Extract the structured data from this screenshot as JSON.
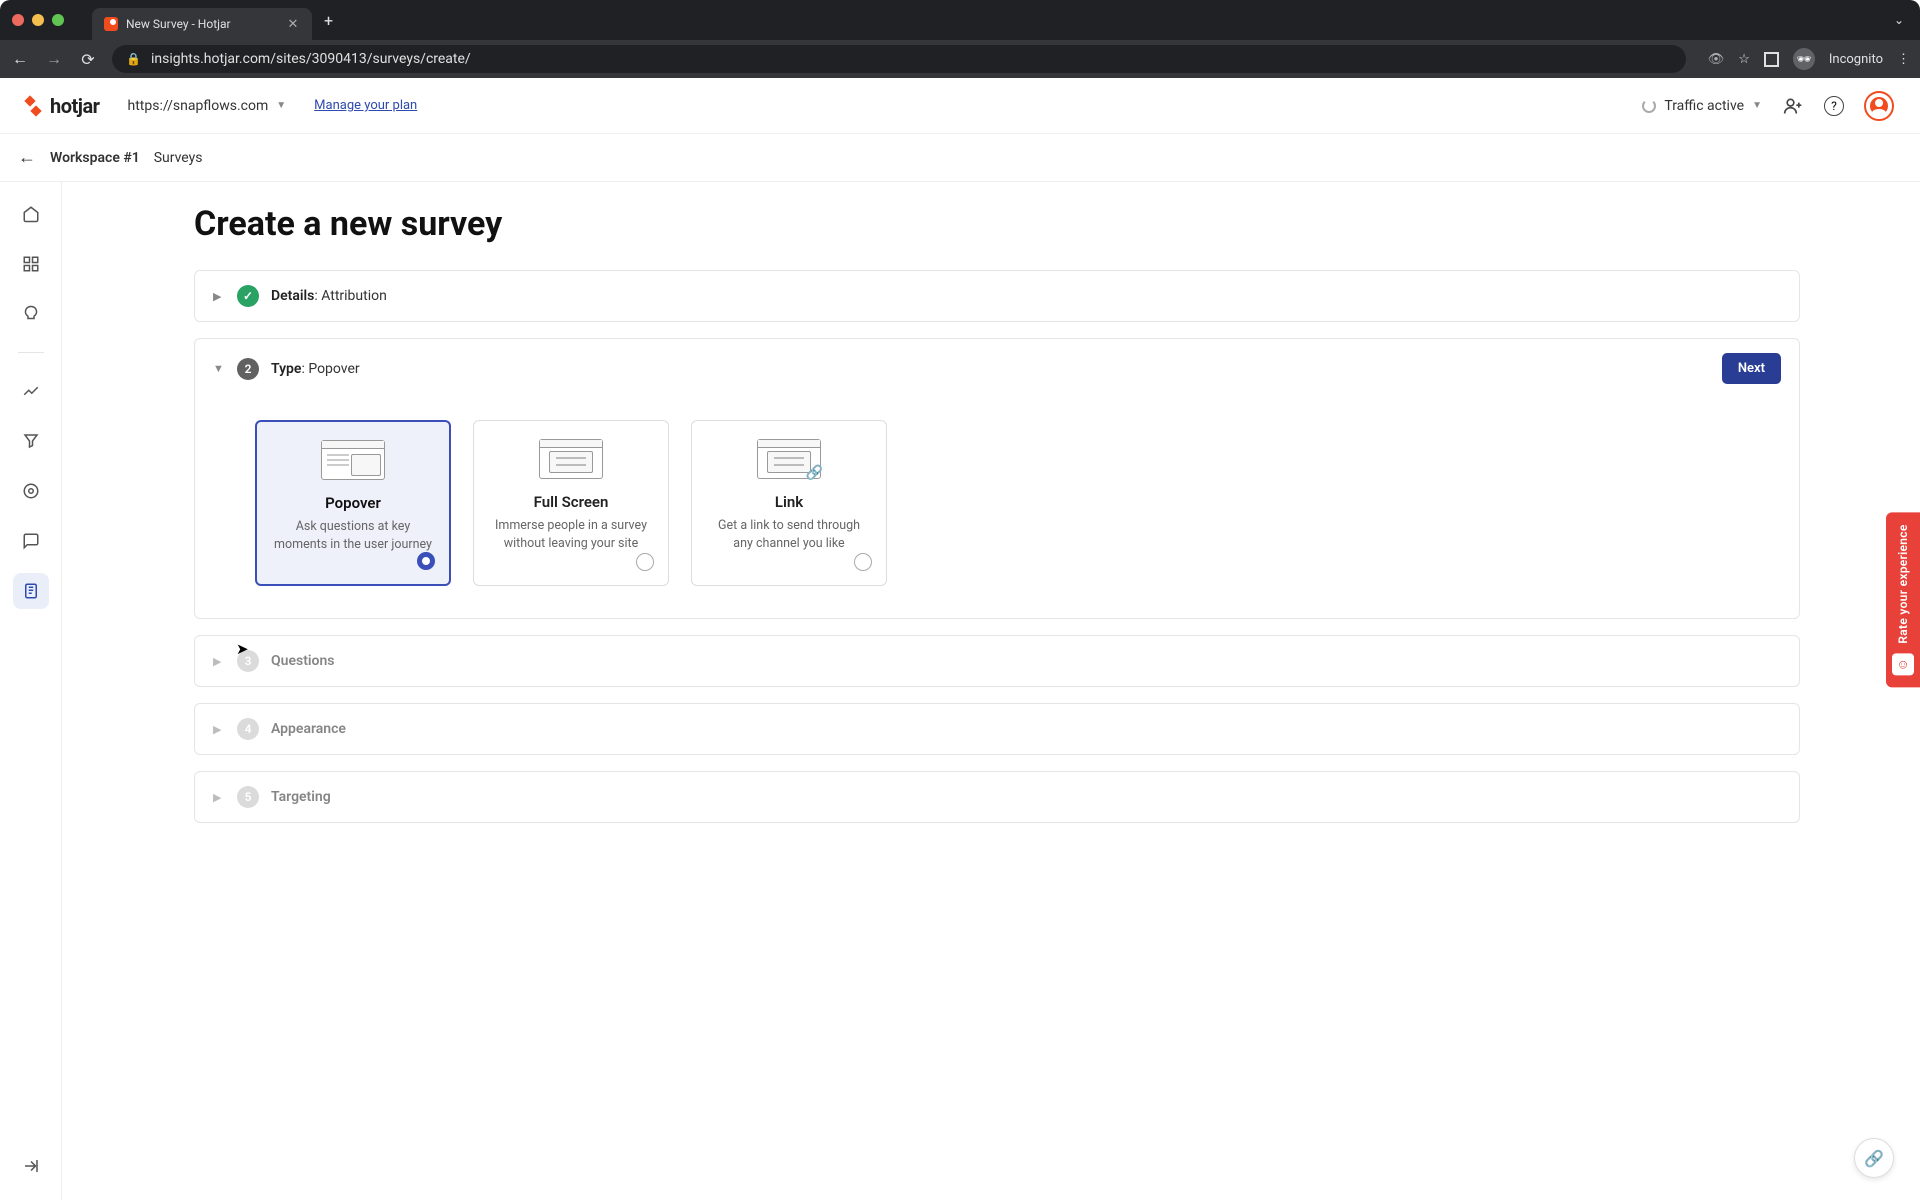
{
  "browser": {
    "tab_title": "New Survey - Hotjar",
    "url": "insights.hotjar.com/sites/3090413/surveys/create/",
    "incognito_label": "Incognito"
  },
  "header": {
    "logo_text": "hotjar",
    "site_dropdown": "https://snapflows.com",
    "manage_plan": "Manage your plan",
    "traffic_label": "Traffic active"
  },
  "breadcrumb": {
    "workspace": "Workspace #1",
    "section": "Surveys"
  },
  "page": {
    "title": "Create a new survey"
  },
  "steps": {
    "details": {
      "label": "Details",
      "value": "Attribution"
    },
    "type": {
      "num": "2",
      "label": "Type",
      "value": "Popover",
      "next_label": "Next",
      "options": [
        {
          "name": "Popover",
          "desc": "Ask questions at key moments in the user journey",
          "selected": true
        },
        {
          "name": "Full Screen",
          "desc": "Immerse people in a survey without leaving your site",
          "selected": false
        },
        {
          "name": "Link",
          "desc": "Get a link to send through any channel you like",
          "selected": false
        }
      ]
    },
    "questions": {
      "num": "3",
      "label": "Questions"
    },
    "appearance": {
      "num": "4",
      "label": "Appearance"
    },
    "targeting": {
      "num": "5",
      "label": "Targeting"
    }
  },
  "rate_tab": "Rate your experience"
}
